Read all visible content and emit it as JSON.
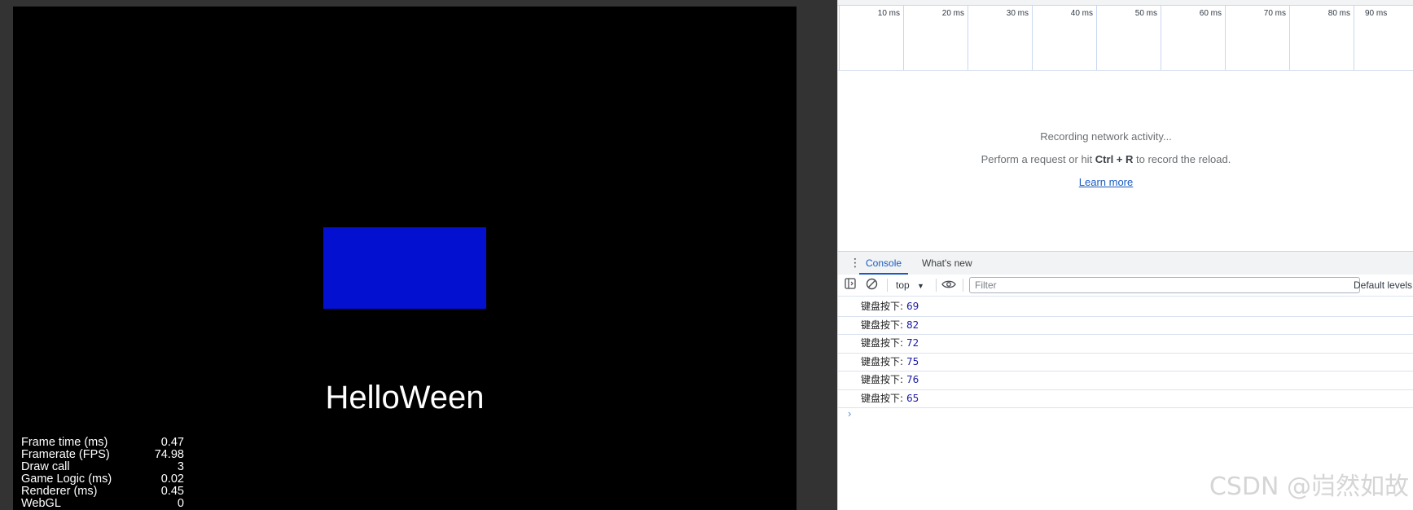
{
  "game": {
    "title_text": "HelloWeen",
    "rect_color": "#0410d0",
    "stats": [
      {
        "label": "Frame time (ms)",
        "value": "0.47"
      },
      {
        "label": "Framerate (FPS)",
        "value": "74.98"
      },
      {
        "label": "Draw call",
        "value": "3"
      },
      {
        "label": "Game Logic (ms)",
        "value": "0.02"
      },
      {
        "label": "Renderer (ms)",
        "value": "0.45"
      },
      {
        "label": "WebGL",
        "value": "0"
      }
    ]
  },
  "network": {
    "ticks": [
      "10 ms",
      "20 ms",
      "30 ms",
      "40 ms",
      "50 ms",
      "60 ms",
      "70 ms",
      "80 ms",
      "90 ms"
    ],
    "recording_text": "Recording network activity...",
    "perform_prefix": "Perform a request or hit ",
    "perform_keys": "Ctrl + R",
    "perform_suffix": " to record the reload.",
    "learn_more": "Learn more"
  },
  "drawer": {
    "tabs": [
      "Console",
      "What's new"
    ]
  },
  "console_toolbar": {
    "context": "top",
    "filter_placeholder": "Filter",
    "levels": "Default levels"
  },
  "console": {
    "messages": [
      {
        "text": "键盘按下:",
        "num": "69"
      },
      {
        "text": "键盘按下:",
        "num": "82"
      },
      {
        "text": "键盘按下:",
        "num": "72"
      },
      {
        "text": "键盘按下:",
        "num": "75"
      },
      {
        "text": "键盘按下:",
        "num": "76"
      },
      {
        "text": "键盘按下:",
        "num": "65"
      }
    ],
    "prompt": "›"
  },
  "watermark": "CSDN @岿然如故"
}
